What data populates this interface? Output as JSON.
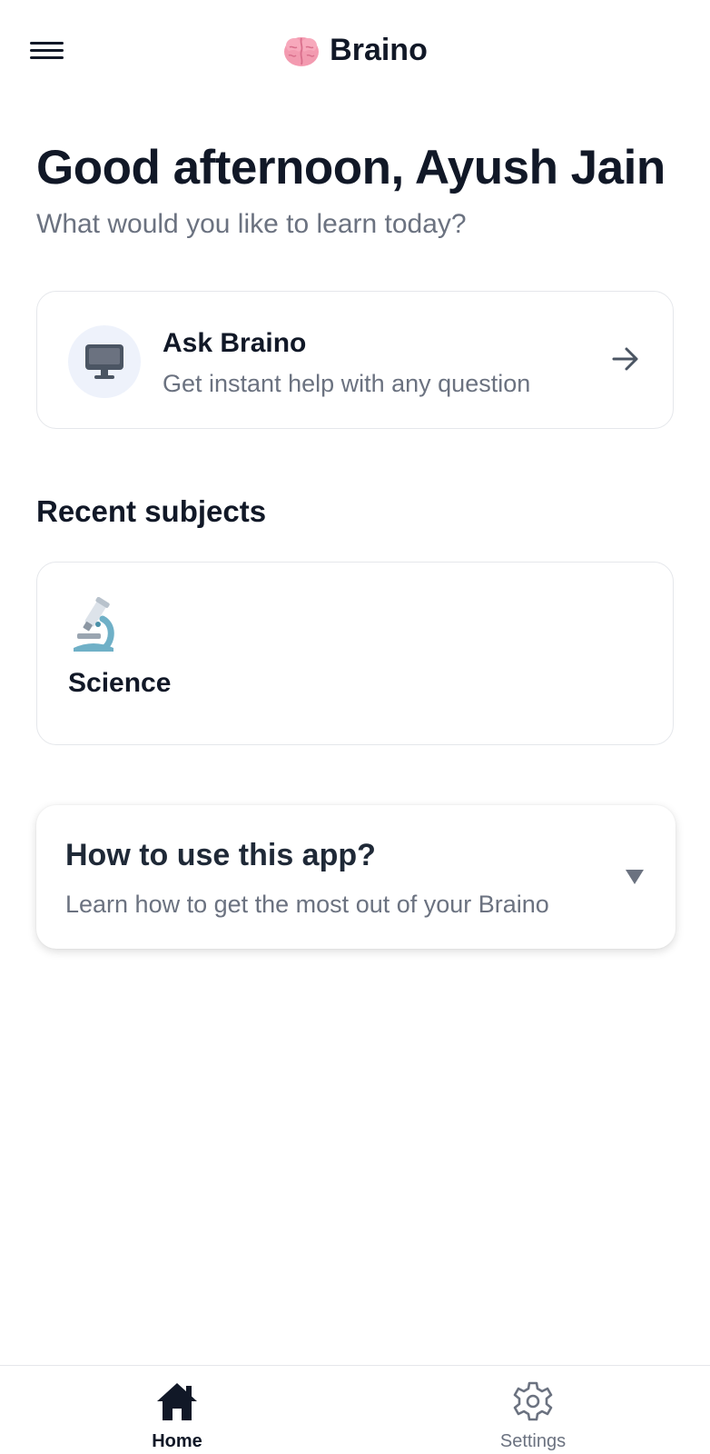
{
  "header": {
    "title": "Braino",
    "logo_icon": "brain-icon",
    "menu_icon": "hamburger-menu-icon"
  },
  "greeting": {
    "title": "Good afternoon, Ayush Jain",
    "subtitle": "What would you like to learn today?"
  },
  "ask_card": {
    "title": "Ask Braino",
    "subtitle": "Get instant help with any question",
    "icon": "monitor-icon",
    "action_icon": "arrow-right-icon"
  },
  "recent_subjects": {
    "heading": "Recent subjects",
    "items": [
      {
        "label": "Science",
        "icon": "microscope-icon"
      }
    ]
  },
  "howto_card": {
    "title": "How to use this app?",
    "subtitle": "Learn how to get the most out of your Braino",
    "expand_icon": "chevron-down-icon"
  },
  "bottom_nav": {
    "items": [
      {
        "label": "Home",
        "icon": "home-icon",
        "active": true
      },
      {
        "label": "Settings",
        "icon": "gear-icon",
        "active": false
      }
    ]
  },
  "colors": {
    "text_primary": "#111827",
    "text_secondary": "#6b7280",
    "card_border": "#e5e7eb",
    "icon_bg": "#eef2fb",
    "brain_pink": "#f49ab0"
  }
}
